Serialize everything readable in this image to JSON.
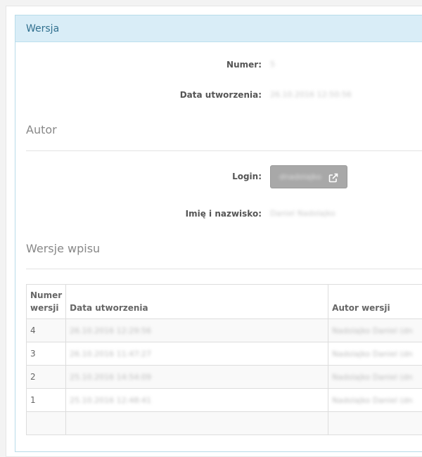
{
  "panel": {
    "title": "Wersja"
  },
  "version_info": {
    "number_label": "Numer:",
    "number_value": "5",
    "created_label": "Data utworzenia:",
    "created_value": "26.10.2016 12:50:56"
  },
  "author": {
    "section_title": "Autor",
    "login_label": "Login:",
    "login_button_text": "dnadolajko",
    "fullname_label": "Imię i nazwisko:",
    "fullname_value": "Daniel Nadolajko"
  },
  "entry_versions": {
    "section_title": "Wersje wpisu",
    "headers": {
      "number_line1": "Numer",
      "number_line2": "wersji",
      "created": "Data utworzenia",
      "author": "Autor wersji"
    },
    "rows": [
      {
        "number": "4",
        "created": "26.10.2016 12:29:56",
        "author": "Nadolajko Daniel (dn"
      },
      {
        "number": "3",
        "created": "26.10.2016 11:47:27",
        "author": "Nadolajko Daniel (dn"
      },
      {
        "number": "2",
        "created": "25.10.2016 14:54:09",
        "author": "Nadolajko Daniel (dn"
      },
      {
        "number": "1",
        "created": "25.10.2016 12:48:41",
        "author": "Nadolajko Daniel (dn"
      }
    ]
  },
  "colors": {
    "heading_bg": "#d9edf7",
    "heading_text": "#31708f",
    "button_bg": "#a8a8a8"
  }
}
